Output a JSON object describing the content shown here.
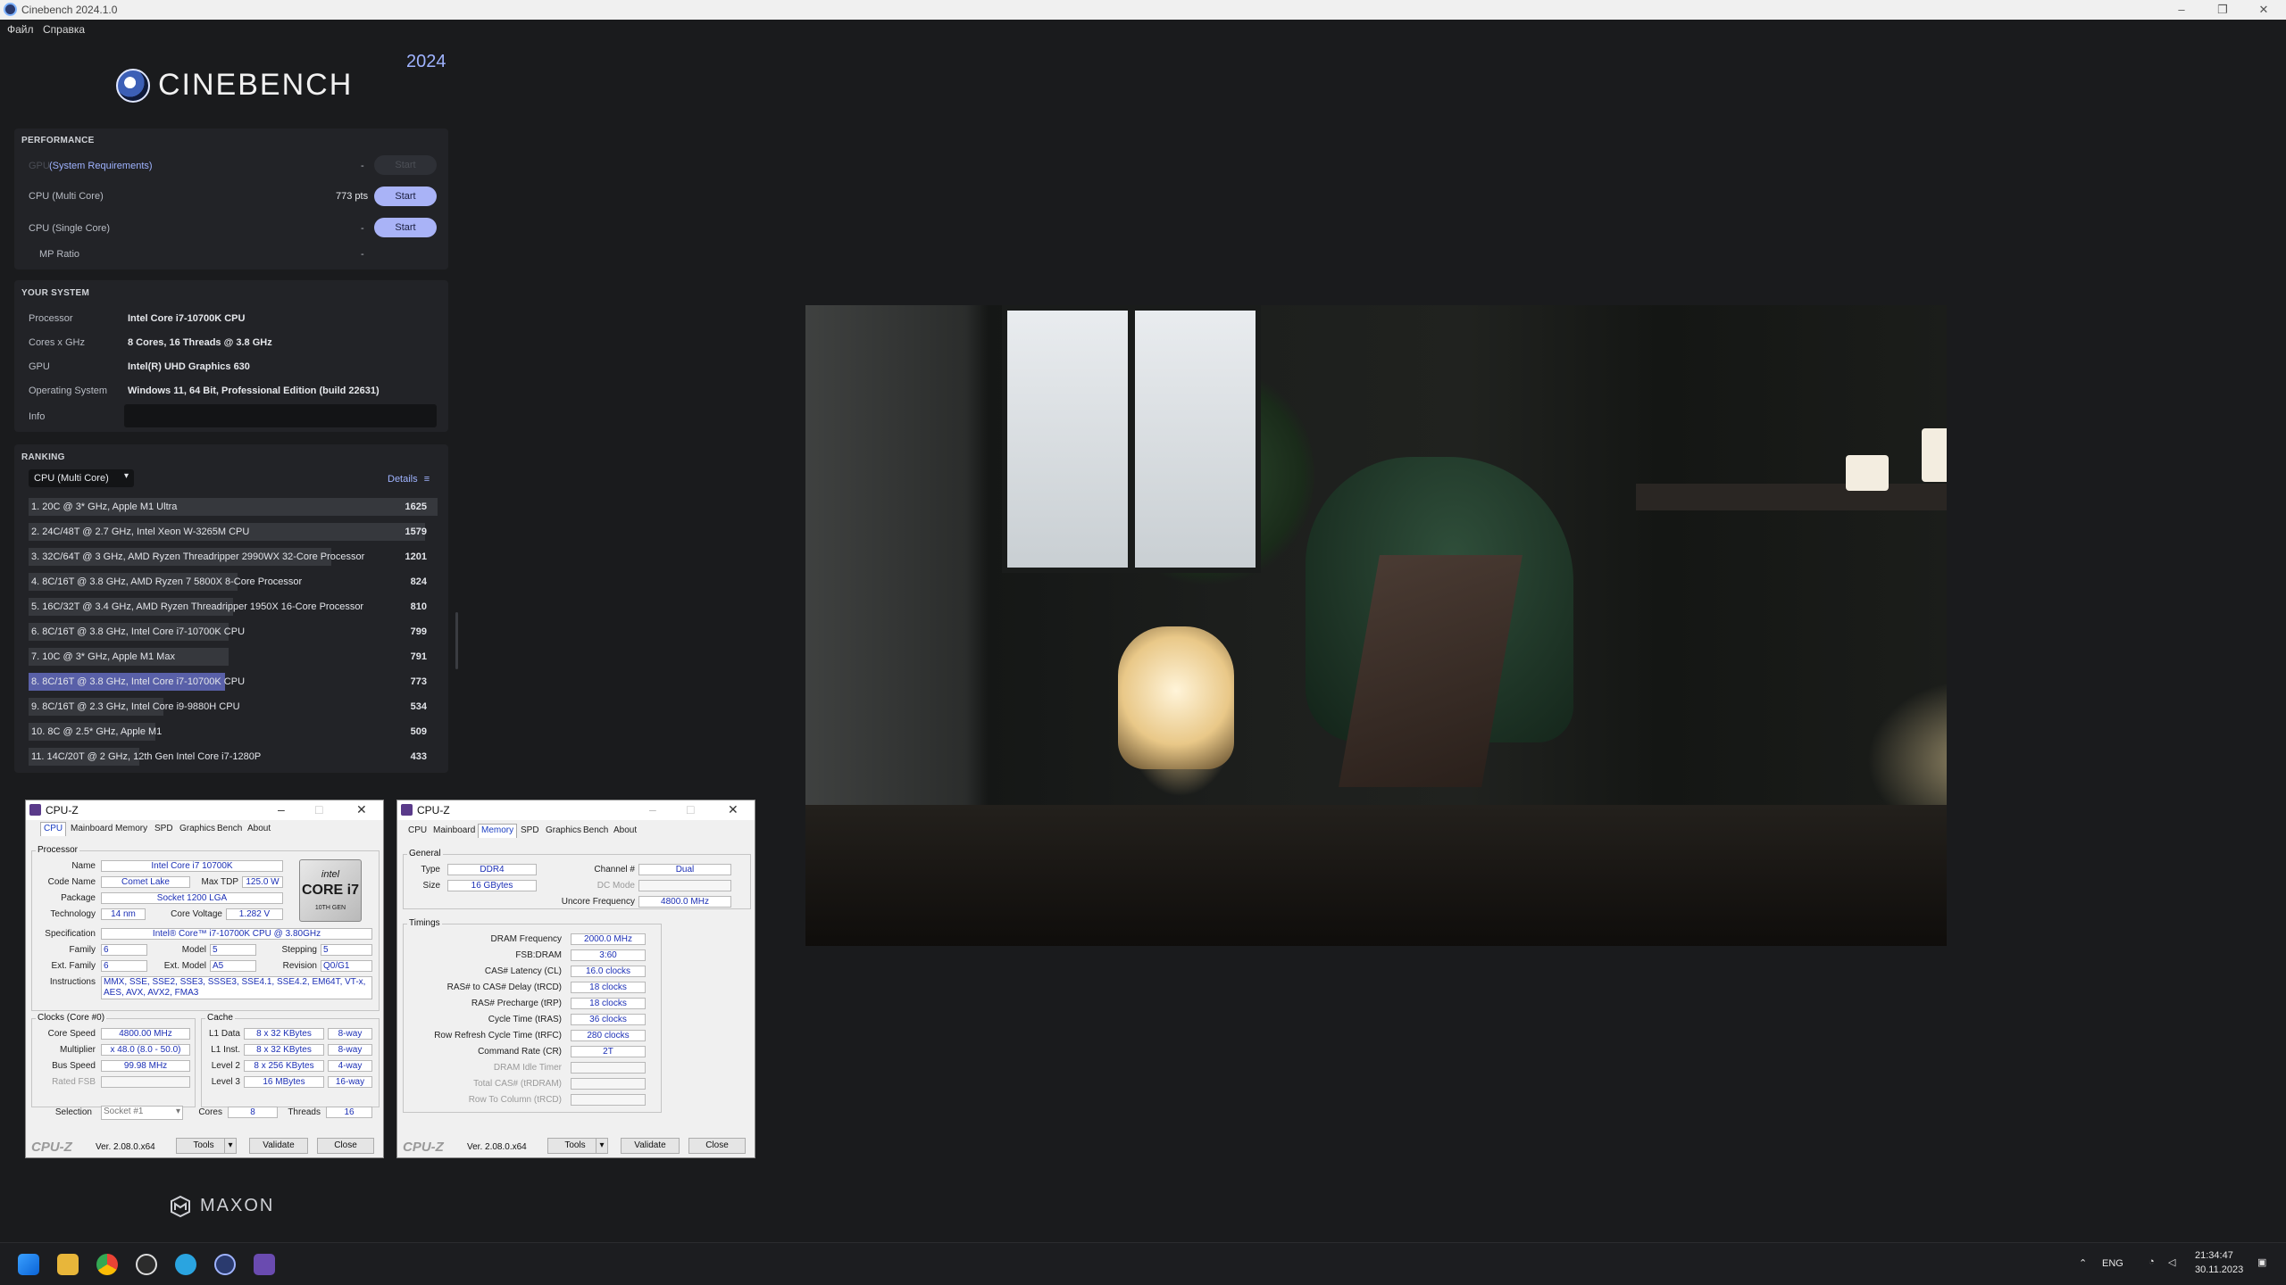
{
  "window": {
    "title": "Cinebench 2024.1.0"
  },
  "menu": {
    "file": "Файл",
    "help": "Справка"
  },
  "header": {
    "logo": "CINEBENCH",
    "year": "2024"
  },
  "performance": {
    "section": "PERFORMANCE",
    "gpu_label": "GPU",
    "gpu_req": "(System Requirements)",
    "gpu_score": "-",
    "multi_label": "CPU (Multi Core)",
    "multi_score": "773 pts",
    "single_label": "CPU (Single Core)",
    "single_score": "-",
    "mp_label": "MP Ratio",
    "mp_score": "-",
    "start": "Start"
  },
  "system": {
    "section": "YOUR SYSTEM",
    "processor_label": "Processor",
    "processor": "Intel Core i7-10700K CPU",
    "cores_label": "Cores x GHz",
    "cores": "8 Cores, 16 Threads @ 3.8 GHz",
    "gpu_label": "GPU",
    "gpu": "Intel(R) UHD Graphics 630",
    "os_label": "Operating System",
    "os": "Windows 11, 64 Bit, Professional Edition (build 22631)",
    "info_label": "Info"
  },
  "ranking": {
    "section": "RANKING",
    "dropdown": "CPU (Multi Core)",
    "details": "Details",
    "rows": [
      {
        "label": "1. 20C @ 3* GHz, Apple M1 Ultra",
        "score": "1625",
        "frac": 1.0
      },
      {
        "label": "2. 24C/48T @ 2.7 GHz, Intel Xeon W-3265M CPU",
        "score": "1579",
        "frac": 0.97
      },
      {
        "label": "3. 32C/64T @ 3 GHz, AMD Ryzen Threadripper 2990WX 32-Core Processor",
        "score": "1201",
        "frac": 0.74
      },
      {
        "label": "4. 8C/16T @ 3.8 GHz, AMD Ryzen 7 5800X 8-Core Processor",
        "score": "824",
        "frac": 0.51
      },
      {
        "label": "5. 16C/32T @ 3.4 GHz, AMD Ryzen Threadripper 1950X 16-Core Processor",
        "score": "810",
        "frac": 0.5
      },
      {
        "label": "6. 8C/16T @ 3.8 GHz, Intel Core i7-10700K CPU",
        "score": "799",
        "frac": 0.49
      },
      {
        "label": "7. 10C @ 3* GHz, Apple M1 Max",
        "score": "791",
        "frac": 0.49
      },
      {
        "label": "8. 8C/16T @ 3.8 GHz, Intel Core i7-10700K CPU",
        "score": "773",
        "frac": 0.48,
        "highlight": true
      },
      {
        "label": "9. 8C/16T @ 2.3 GHz, Intel Core i9-9880H CPU",
        "score": "534",
        "frac": 0.33
      },
      {
        "label": "10. 8C @ 2.5* GHz, Apple M1",
        "score": "509",
        "frac": 0.31
      },
      {
        "label": "11. 14C/20T @ 2 GHz, 12th Gen Intel Core i7-1280P",
        "score": "433",
        "frac": 0.27
      }
    ]
  },
  "footer": {
    "maxon": "MAXON"
  },
  "cpuz1": {
    "title": "CPU-Z",
    "tabs": [
      "CPU",
      "Mainboard",
      "Memory",
      "SPD",
      "Graphics",
      "Bench",
      "About"
    ],
    "processor_group": "Processor",
    "name_label": "Name",
    "name": "Intel Core i7 10700K",
    "codename_label": "Code Name",
    "codename": "Comet Lake",
    "maxtdp_label": "Max TDP",
    "maxtdp": "125.0 W",
    "package_label": "Package",
    "package": "Socket 1200 LGA",
    "tech_label": "Technology",
    "tech": "14 nm",
    "voltage_label": "Core Voltage",
    "voltage": "1.282 V",
    "spec_label": "Specification",
    "spec": "Intel® Core™ i7-10700K CPU @ 3.80GHz",
    "family_label": "Family",
    "family": "6",
    "model_label": "Model",
    "model": "5",
    "stepping_label": "Stepping",
    "stepping": "5",
    "extfamily_label": "Ext. Family",
    "extfamily": "6",
    "extmodel_label": "Ext. Model",
    "extmodel": "A5",
    "revision_label": "Revision",
    "revision": "Q0/G1",
    "instr_label": "Instructions",
    "instr": "MMX, SSE, SSE2, SSE3, SSSE3, SSE4.1, SSE4.2, EM64T, VT-x, AES, AVX, AVX2, FMA3",
    "intel_a": "intel",
    "intel_b": "CORE i7",
    "intel_c": "10TH GEN",
    "clocks_group": "Clocks (Core #0)",
    "corespeed_label": "Core Speed",
    "corespeed": "4800.00 MHz",
    "mult_label": "Multiplier",
    "mult": "x 48.0 (8.0 - 50.0)",
    "bus_label": "Bus Speed",
    "bus": "99.98 MHz",
    "rated_label": "Rated FSB",
    "cache_group": "Cache",
    "l1d_label": "L1 Data",
    "l1d": "8 x 32 KBytes",
    "l1d_way": "8-way",
    "l1i_label": "L1 Inst.",
    "l1i": "8 x 32 KBytes",
    "l1i_way": "8-way",
    "l2_label": "Level 2",
    "l2": "8 x 256 KBytes",
    "l2_way": "4-way",
    "l3_label": "Level 3",
    "l3": "16 MBytes",
    "l3_way": "16-way",
    "selection_label": "Selection",
    "selection": "Socket #1",
    "cores_label": "Cores",
    "cores": "8",
    "threads_label": "Threads",
    "threads": "16",
    "logo": "CPU-Z",
    "version": "Ver. 2.08.0.x64",
    "tools": "Tools",
    "validate": "Validate",
    "close": "Close"
  },
  "cpuz2": {
    "title": "CPU-Z",
    "tabs": [
      "CPU",
      "Mainboard",
      "Memory",
      "SPD",
      "Graphics",
      "Bench",
      "About"
    ],
    "general_group": "General",
    "type_label": "Type",
    "type": "DDR4",
    "size_label": "Size",
    "size": "16 GBytes",
    "channel_label": "Channel #",
    "channel": "Dual",
    "dcmode_label": "DC Mode",
    "uncore_label": "Uncore Frequency",
    "uncore": "4800.0 MHz",
    "timings_group": "Timings",
    "dram_label": "DRAM Frequency",
    "dram": "2000.0 MHz",
    "fsb_label": "FSB:DRAM",
    "fsb": "3:60",
    "cl_label": "CAS# Latency (CL)",
    "cl": "16.0 clocks",
    "trcd_label": "RAS# to CAS# Delay (tRCD)",
    "trcd": "18 clocks",
    "trp_label": "RAS# Precharge (tRP)",
    "trp": "18 clocks",
    "tras_label": "Cycle Time (tRAS)",
    "tras": "36 clocks",
    "trfc_label": "Row Refresh Cycle Time (tRFC)",
    "trfc": "280 clocks",
    "cr_label": "Command Rate (CR)",
    "cr": "2T",
    "idle_label": "DRAM Idle Timer",
    "trdram_label": "Total CAS# (tRDRAM)",
    "trcd2_label": "Row To Column (tRCD)",
    "logo": "CPU-Z",
    "version": "Ver. 2.08.0.x64",
    "tools": "Tools",
    "validate": "Validate",
    "close": "Close"
  },
  "taskbar": {
    "lang": "ENG",
    "time": "21:34:47",
    "date": "30.11.2023"
  }
}
